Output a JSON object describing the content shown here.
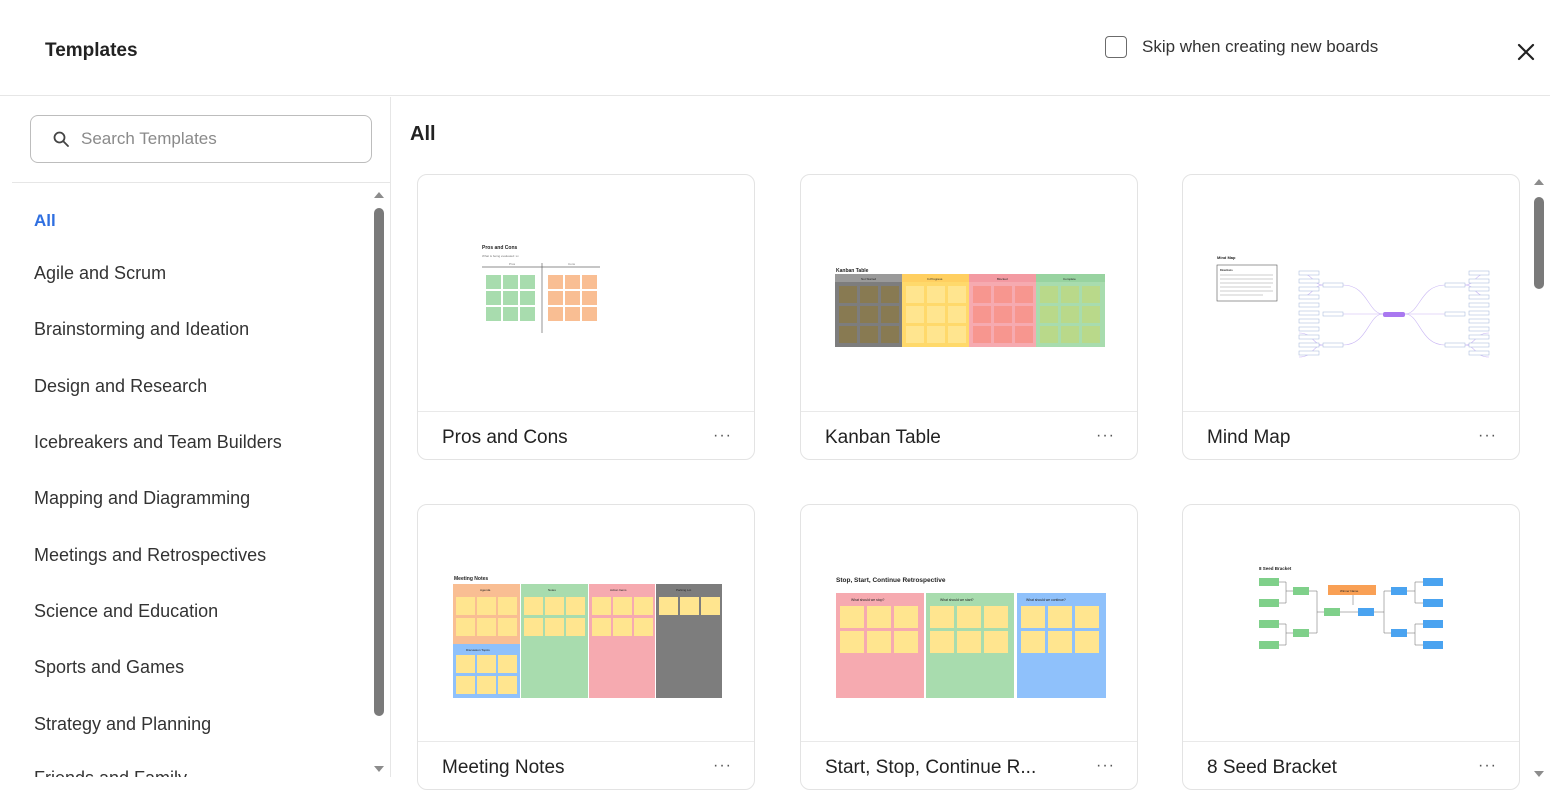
{
  "header": {
    "title": "Templates",
    "skip_label": "Skip when creating new boards"
  },
  "sidebar": {
    "search_placeholder": "Search Templates",
    "categories": [
      "All",
      "Agile and Scrum",
      "Brainstorming and Ideation",
      "Design and Research",
      "Icebreakers and Team Builders",
      "Mapping and Diagramming",
      "Meetings and Retrospectives",
      "Science and Education",
      "Sports and Games",
      "Strategy and Planning",
      "Friends and Family"
    ],
    "active_category": "All"
  },
  "main": {
    "heading": "All",
    "more_label": "···",
    "templates": [
      {
        "name": "Pros and Cons",
        "thumb_title": "Pros and Cons",
        "thumb_sub": "What is being evaluated: xx",
        "col_a": "Pros",
        "col_b": "Cons"
      },
      {
        "name": "Kanban Table",
        "thumb_title": "Kanban Table",
        "columns": [
          "Not Started",
          "In Progress",
          "Blocked",
          "Complete"
        ]
      },
      {
        "name": "Mind Map",
        "thumb_title": "Mind Map",
        "note_title": "Directions"
      },
      {
        "name": "Meeting Notes",
        "thumb_title": "Meeting Notes",
        "columns": [
          "Agenda",
          "Notes",
          "Action Items",
          "Parking Lot"
        ],
        "sub_column": "Discussion Topics"
      },
      {
        "name": "Start, Stop, Continue R...",
        "thumb_title": "Stop, Start, Continue Retrospective",
        "columns": [
          "What should we stop?",
          "What should we start?",
          "What should we continue?"
        ]
      },
      {
        "name": "8 Seed Bracket",
        "thumb_title": "8 Seed Bracket",
        "center_label": "Winner Name",
        "team_label": "Team"
      }
    ]
  },
  "colors": {
    "accent": "#2f6fe0",
    "sticky_yellow": "#ffe58f",
    "green": "#a8dcae",
    "orange": "#f9be93",
    "red": "#f6aab0",
    "gray": "#7d7d7d",
    "blue": "#8fc1fb",
    "purple": "#a978f0"
  }
}
